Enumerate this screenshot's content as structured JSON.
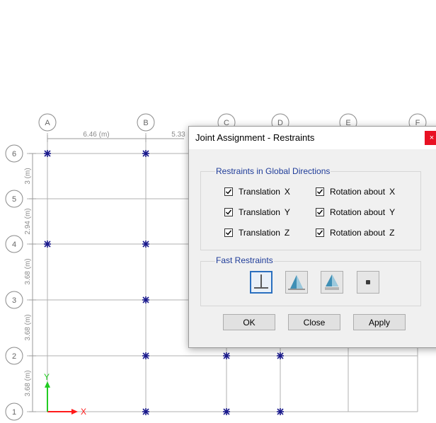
{
  "grid": {
    "column_labels": [
      "A",
      "B",
      "C",
      "D",
      "E",
      "F"
    ],
    "row_labels": [
      "6",
      "5",
      "4",
      "3",
      "2",
      "1"
    ],
    "column_spacing_labels": [
      "6.46 (m)",
      "5.33"
    ],
    "row_spacing_labels": [
      "3 (m)",
      "2.94 (m)",
      "3.68 (m)",
      "3.68 (m)",
      "3.68 (m)"
    ],
    "axis_x_label": "X",
    "axis_y_label": "Y",
    "colors": {
      "grid_line": "#b0b0b0",
      "bubble": "#8a8a8a",
      "joint": "#1a1a8c",
      "axis_x": "#ff1a1a",
      "axis_y": "#22cc22"
    }
  },
  "dialog": {
    "title": "Joint Assignment - Restraints",
    "close_glyph": "×",
    "global_group_label": "Restraints in Global Directions",
    "restraints": [
      {
        "label": "Translation",
        "axis": "X",
        "checked": true
      },
      {
        "label": "Translation",
        "axis": "Y",
        "checked": true
      },
      {
        "label": "Translation",
        "axis": "Z",
        "checked": true
      },
      {
        "label": "Rotation about",
        "axis": "X",
        "checked": true
      },
      {
        "label": "Rotation about",
        "axis": "Y",
        "checked": true
      },
      {
        "label": "Rotation about",
        "axis": "Z",
        "checked": true
      }
    ],
    "fast_group_label": "Fast Restraints",
    "fast_buttons": [
      "fixed-support-icon",
      "pinned-support-icon",
      "roller-support-icon",
      "free-joint-icon"
    ],
    "ok_label": "OK",
    "close_label": "Close",
    "apply_label": "Apply"
  }
}
